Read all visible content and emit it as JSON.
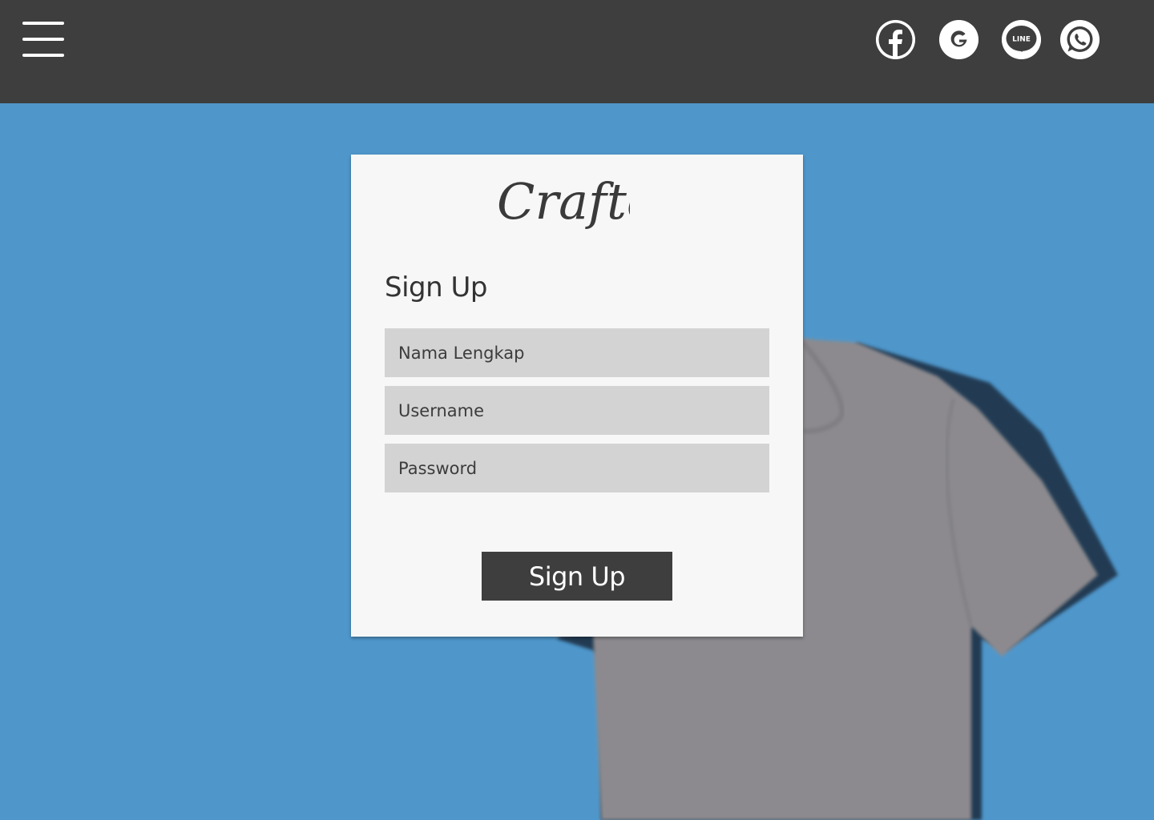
{
  "header": {
    "menu_icon": "hamburger-menu-icon",
    "social_icons": [
      "facebook-icon",
      "google-icon",
      "line-icon",
      "whatsapp-icon"
    ],
    "line_icon_text": "LINE"
  },
  "card": {
    "logo_text": "Crafto",
    "title": "Sign Up",
    "fields": {
      "full_name_placeholder": "Nama Lengkap",
      "username_placeholder": "Username",
      "password_placeholder": "Password"
    },
    "submit_label": "Sign Up"
  },
  "colors": {
    "header_bg": "#3e3e3e",
    "page_bg": "#4f97cb",
    "card_bg": "#f7f7f7",
    "input_bg": "#d3d3d3",
    "button_bg": "#3e3e3e",
    "shirt": "#8c8a8e"
  }
}
